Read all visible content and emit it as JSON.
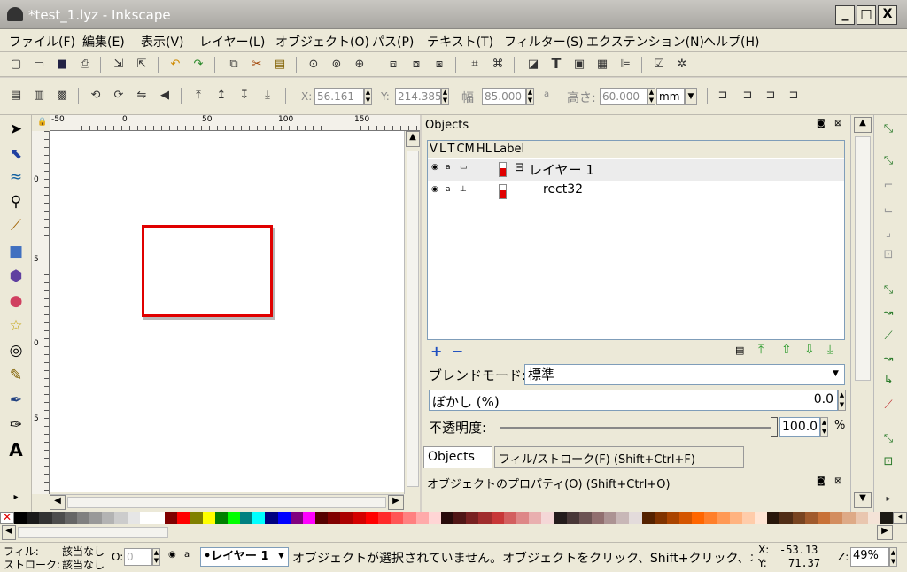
{
  "window": {
    "title": "*test_1.lyz - Inkscape",
    "min": "_",
    "max": "□",
    "close": "X"
  },
  "menu": [
    "ファイル(F)",
    "編集(E)",
    "表示(V)",
    "レイヤー(L)",
    "オブジェクト(O)",
    "パス(P)",
    "テキスト(T)",
    "フィルター(S)",
    "エクステンション(N)",
    "ヘルプ(H)"
  ],
  "controls": {
    "x_label": "X:",
    "x_value": "56.161",
    "y_label": "Y:",
    "y_value": "214.385",
    "w_label": "幅",
    "w_value": "85.000",
    "h_label": "高さ:",
    "h_value": "60.000",
    "unit": "mm"
  },
  "ruler": {
    "h_ticks": [
      "-50",
      "0",
      "50",
      "100",
      "150"
    ],
    "v_ticks": [
      "0",
      "5",
      "0",
      "5"
    ]
  },
  "objects_panel": {
    "title": "Objects",
    "columns": "V L T CM HL Label",
    "rows": [
      {
        "label": "レイヤー 1",
        "expander": "⊟"
      },
      {
        "label": "rect32",
        "expander": ""
      }
    ],
    "blend_label": "ブレンドモード:",
    "blend_value": "標準",
    "blur_label": "ぼかし (%)",
    "blur_value": "0.0",
    "opacity_label": "不透明度:",
    "opacity_value": "100.0",
    "opacity_unit": "%",
    "tab_objects": "Objects",
    "tab_fill": "フィル/ストローク(F) (Shift+Ctrl+F)",
    "props_title": "オブジェクトのプロパティ(O) (Shift+Ctrl+O)"
  },
  "status": {
    "fill_label": "フィル:",
    "fill_value": "該当なし",
    "stroke_label": "ストローク:",
    "stroke_value": "該当なし",
    "o_label": "O:",
    "o_value": "0",
    "layer": "•レイヤー 1",
    "message": "オブジェクトが選択されていません。オブジェクトをクリック、Shift+クリック、オブジ…",
    "x_label": "X:",
    "x_value": "-53.13",
    "y_label": "Y:",
    "y_value": "71.37",
    "z_label": "Z:",
    "zoom": "49%"
  },
  "palette": [
    "#000000",
    "#1a1a1a",
    "#333333",
    "#4d4d4d",
    "#666666",
    "#808080",
    "#999999",
    "#b3b3b3",
    "#cccccc",
    "#e6e6e6",
    "#ffffff",
    "#ffffff",
    "#800000",
    "#ff0000",
    "#808000",
    "#ffff00",
    "#008000",
    "#00ff00",
    "#008080",
    "#00ffff",
    "#000080",
    "#0000ff",
    "#800080",
    "#ff00ff",
    "#550000",
    "#800000",
    "#aa0000",
    "#d40000",
    "#ff0000",
    "#ff2a2a",
    "#ff5555",
    "#ff8080",
    "#ffaaaa",
    "#ffd5d5",
    "#280b0b",
    "#501616",
    "#782121",
    "#a02c2c",
    "#c83737",
    "#d35f5f",
    "#de8787",
    "#e9afaf",
    "#f4d7d7",
    "#241c1c",
    "#483737",
    "#6c5353",
    "#916f6f",
    "#ac9393",
    "#c8b7b7",
    "#e3dbdb",
    "#552200",
    "#803300",
    "#aa4400",
    "#d45500",
    "#ff6600",
    "#ff7f2a",
    "#ff9955",
    "#ffb380",
    "#ffccaa",
    "#ffe6d5",
    "#28170b",
    "#502d16",
    "#784421",
    "#a05a2c",
    "#c87137",
    "#d38d5f",
    "#deaa87",
    "#e9c6af",
    "#f4e3d7",
    "#1c1a14"
  ],
  "colors": {
    "rect_stroke": "#e00000",
    "accent": "#e00000"
  }
}
